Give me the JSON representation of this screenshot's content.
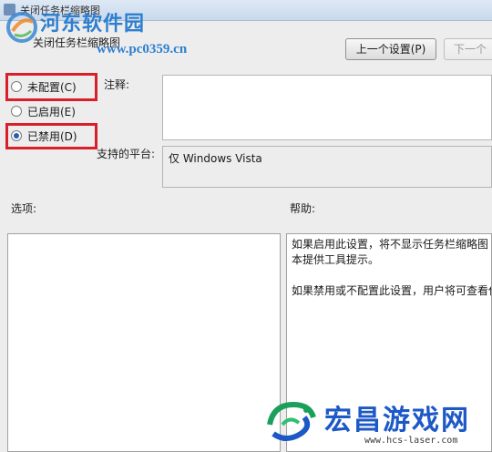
{
  "window": {
    "title": "关闭任务栏缩略图"
  },
  "header": {
    "policy_name": "关闭任务栏缩略图",
    "prev_setting_label": "上一个设置(P)",
    "next_setting_label": "下一个"
  },
  "radios": {
    "not_configured": "未配置(C)",
    "enabled": "已启用(E)",
    "disabled": "已禁用(D)",
    "selected": "disabled"
  },
  "fields": {
    "comment_label": "注释:",
    "comment_value": "",
    "supported_label": "支持的平台:",
    "supported_value": "仅 Windows Vista"
  },
  "sections": {
    "options_label": "选项:",
    "help_label": "帮助:"
  },
  "help": {
    "line1": "如果启用此设置，将不显示任务栏缩略图",
    "line2": "本提供工具提示。",
    "line3": "如果禁用或不配置此设置，用户将可查看任"
  },
  "watermarks": {
    "site1_name": "河东软件园",
    "site1_url": "www.pc0359.cn",
    "site2_name": "宏昌游戏网",
    "site2_url": "www.hcs-laser.com"
  },
  "colors": {
    "highlight": "#d9202a",
    "watermark_blue": "#2e7fd0",
    "watermark2_blue": "#1d58c7"
  }
}
